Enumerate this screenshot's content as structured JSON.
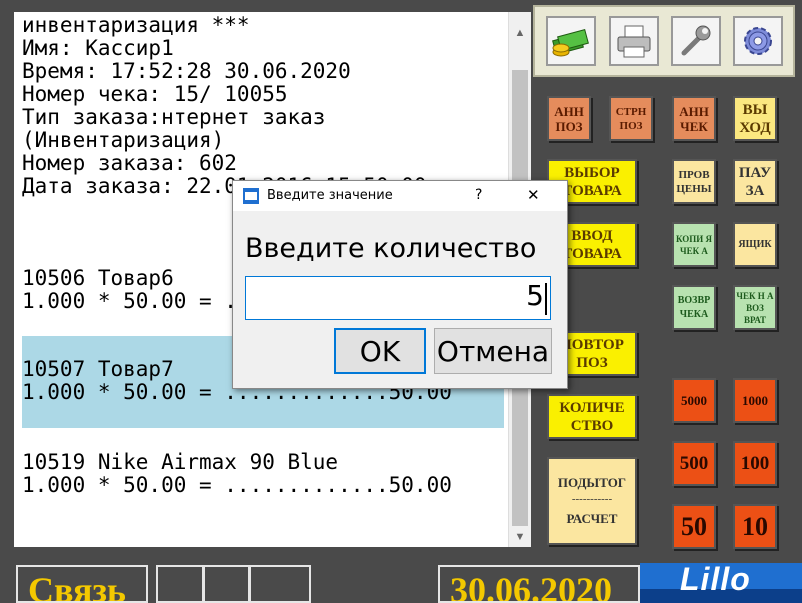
{
  "receipt": {
    "lines": [
      "инвентаризация ***",
      "Имя: Кассир1",
      "Время: 17:52:28 30.06.2020",
      "Номер чека: 15/ 10055",
      "Тип заказа:нтернет заказ",
      "(Инвентаризация)",
      "Номер заказа: 602",
      "Дата заказа: 22.01.2016 15.50.00"
    ],
    "items": [
      {
        "title": "10506 Товар6",
        "calc": "1.000 * 50.00 = .............50.00"
      },
      {
        "title": "10507 Товар7",
        "calc": "1.000 * 50.00 = .............50.00"
      },
      {
        "title": "10519 Nike Airmax 90 Blue",
        "calc": "1.000 * 50.00 = .............50.00"
      }
    ]
  },
  "toolbar": {
    "icons": [
      "money-icon",
      "printer-icon",
      "wrench-icon",
      "gear-icon"
    ]
  },
  "buttons": {
    "ann_poz": "АНН ПОЗ",
    "strn_poz": "СТРН ПОЗ",
    "ann_chek": "АНН ЧЕК",
    "vyhod": "ВЫ ХОД",
    "vybor_tovara": "ВЫБОР ТОВАРА",
    "prov_ceny": "ПРОВ ЦЕНЫ",
    "pauza": "ПАУ ЗА",
    "vvod_tovara": "ВВОД ТОВАРА",
    "kopiya_cheka": "КОПИ Я ЧЕК А",
    "yashik": "ЯЩИК",
    "vozvr_cheka": "ВОЗВР ЧЕКА",
    "chek_na_vozvrat": "ЧЕК Н А ВОЗ ВРАТ",
    "povtor_poz": "ПОВТОР ПОЗ",
    "b5000": "5000",
    "b1000": "1000",
    "kolichestvo": "КОЛИЧЕ СТВО",
    "b500": "500",
    "b100": "100",
    "podytog": "ПОДЫТОГ",
    "podytog_sep": "-----------",
    "raschet": "РАСЧЕТ",
    "b50": "50",
    "b10": "10"
  },
  "dialog": {
    "title": "Введите значение",
    "help": "?",
    "close": "✕",
    "prompt": "Введите количество",
    "value": "5",
    "ok": "OK",
    "cancel": "Отмена"
  },
  "bottom": {
    "status_text": "Связь",
    "date_text": "30.06.2020",
    "logo_text": "Lillo"
  }
}
